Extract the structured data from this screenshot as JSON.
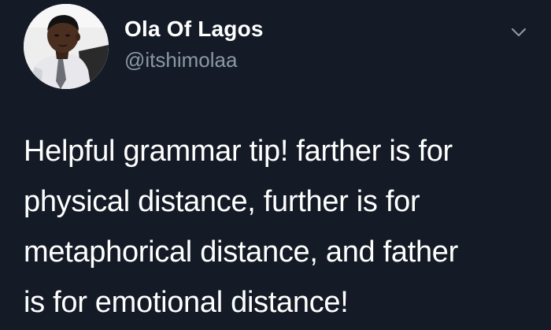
{
  "tweet": {
    "author": {
      "display_name": "Ola Of Lagos",
      "handle": "@itshimolaa",
      "avatar_icon": "profile-photo"
    },
    "menu_icon": "chevron-down-icon",
    "text_lines": [
      "Helpful grammar tip! farther is for",
      "physical distance, further is for",
      "metaphorical distance, and father",
      "is for emotional distance!"
    ]
  },
  "colors": {
    "background": "#141b26",
    "text_primary": "#ffffff",
    "text_secondary": "#8b98a5"
  }
}
